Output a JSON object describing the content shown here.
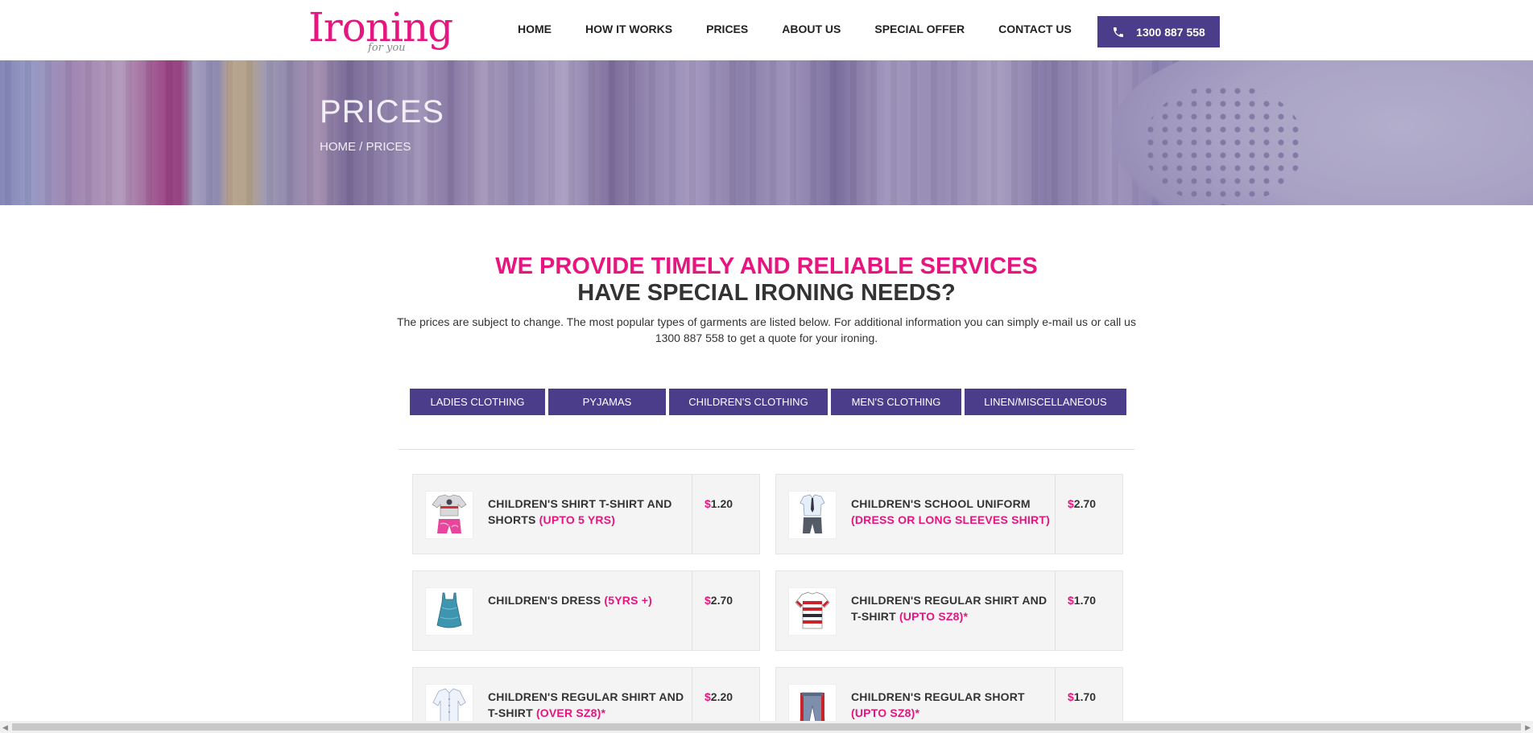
{
  "header": {
    "logo_text": "IronΑng",
    "logo_display": "Ironing",
    "logo_sub": "for you",
    "nav": [
      "HOME",
      "HOW IT WORKS",
      "PRICES",
      "ABOUT US",
      "SPECIAL OFFER",
      "CONTACT US"
    ],
    "phone": "1300 887 558"
  },
  "banner": {
    "title": "PRICES",
    "breadcrumb": "HOME / PRICES"
  },
  "intro": {
    "title": "WE PROVIDE TIMELY AND RELIABLE SERVICES",
    "subtitle": "HAVE SPECIAL IRONING NEEDS?",
    "text_line1": "The prices are subject to change. The most popular types of garments are listed below. For additional information you can simply e-mail us or call us",
    "text_line2": "1300 887 558 to get a quote for your ironing."
  },
  "tabs": [
    "LADIES CLOTHING",
    "PYJAMAS",
    "CHILDREN'S CLOTHING",
    "MEN'S CLOTHING",
    "LINEN/MISCELLANEOUS"
  ],
  "items": [
    {
      "name": "CHILDREN'S SHIRT T-SHIRT AND SHORTS",
      "note": "(UPTO 5 YRS)",
      "currency": "$",
      "price": "1.20"
    },
    {
      "name": "CHILDREN'S SCHOOL UNIFORM",
      "note": "(DRESS OR LONG SLEEVES SHIRT)",
      "currency": "$",
      "price": "2.70"
    },
    {
      "name": "CHILDREN'S DRESS",
      "note": "(5YRS +)",
      "currency": "$",
      "price": "2.70"
    },
    {
      "name": "CHILDREN'S REGULAR SHIRT AND T-SHIRT",
      "note": "(UPTO SZ8)*",
      "currency": "$",
      "price": "1.70"
    },
    {
      "name": "CHILDREN'S REGULAR SHIRT AND T-SHIRT",
      "note": "(OVER SZ8)*",
      "currency": "$",
      "price": "2.20"
    },
    {
      "name": "CHILDREN'S REGULAR SHORT",
      "note": "(UPTO SZ8)*",
      "currency": "$",
      "price": "1.70"
    }
  ],
  "colors": {
    "brand_pink": "#e6157f",
    "brand_purple": "#4b3d8a"
  }
}
